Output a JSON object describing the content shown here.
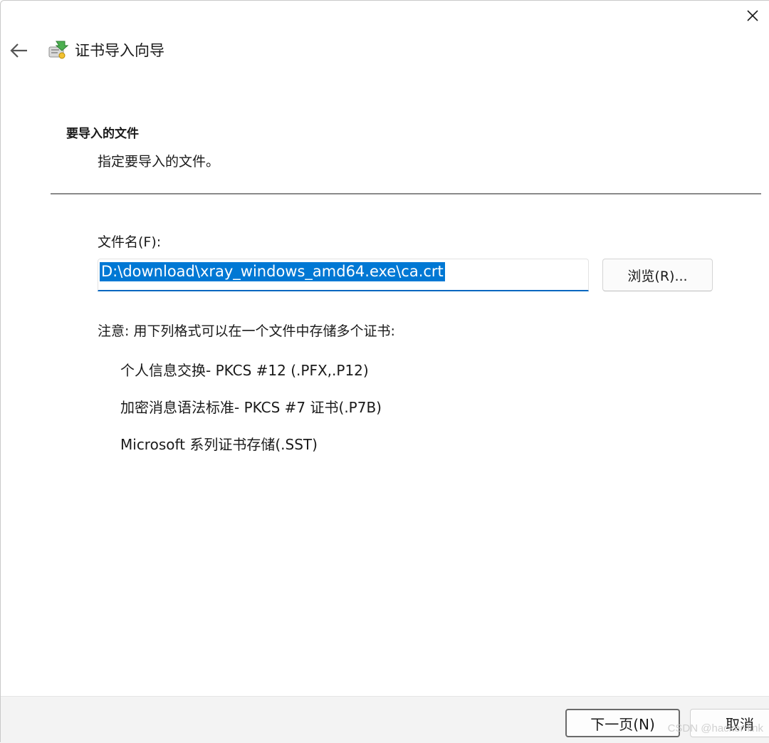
{
  "window": {
    "title": "证书导入向导"
  },
  "page": {
    "heading": "要导入的文件",
    "subheading": "指定要导入的文件。"
  },
  "file_field": {
    "label": "文件名(F):",
    "value": "D:\\download\\xray_windows_amd64.exe\\ca.crt",
    "browse_label": "浏览(R)..."
  },
  "note": {
    "text": "注意: 用下列格式可以在一个文件中存储多个证书:",
    "formats": [
      "个人信息交换- PKCS #12 (.PFX,.P12)",
      "加密消息语法标准- PKCS #7 证书(.P7B)",
      "Microsoft 系列证书存储(.SST)"
    ]
  },
  "footer": {
    "next_label": "下一页(N)",
    "cancel_label": "取消"
  },
  "watermark": "CSDN @hacker-link",
  "colors": {
    "accent": "#0067c0",
    "selection": "#0078d4",
    "footer_bg": "#f3f3f3"
  }
}
